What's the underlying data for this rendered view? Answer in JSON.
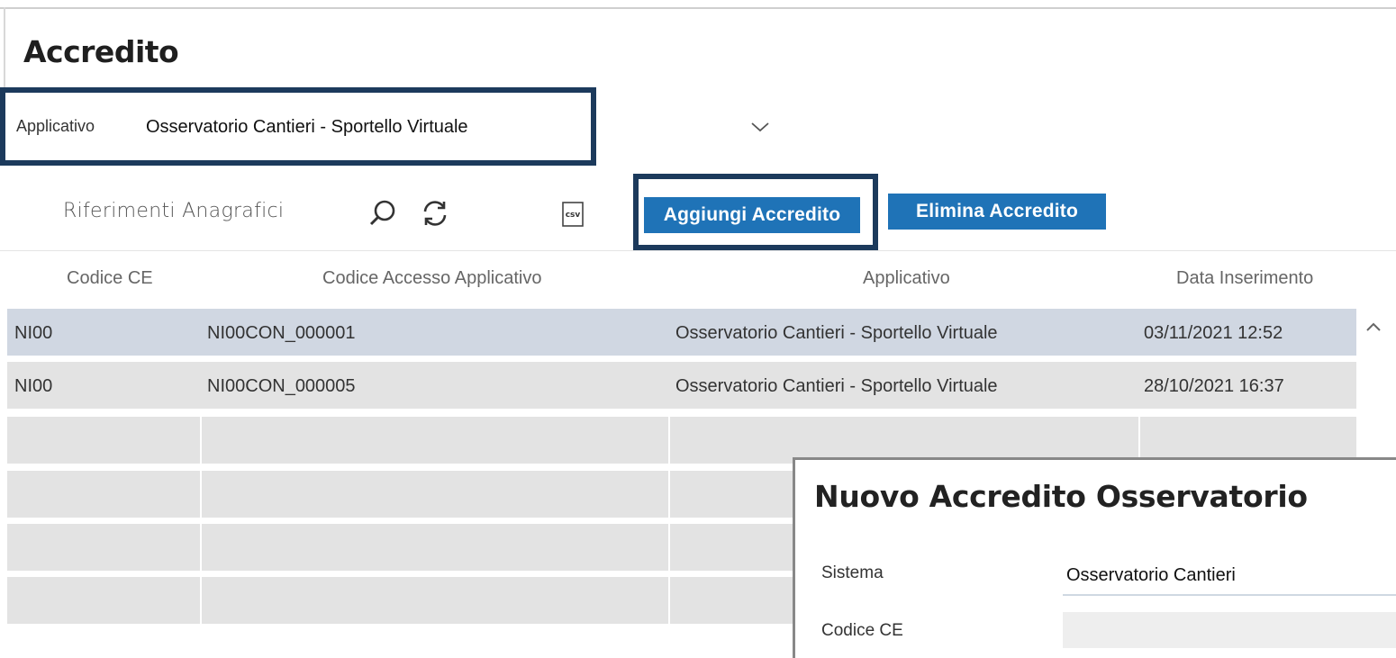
{
  "page": {
    "title": "Accredito"
  },
  "applicativo": {
    "label": "Applicativo",
    "value": "Osservatorio Cantieri - Sportello Virtuale"
  },
  "toolbar": {
    "riferimenti_label": "Riferimenti Anagrafici",
    "csv_icon_text": "csv",
    "add_label": "Aggiungi Accredito",
    "delete_label": "Elimina Accredito"
  },
  "table": {
    "headers": [
      "Codice CE",
      "Codice Accesso Applicativo",
      "Applicativo",
      "Data Inserimento"
    ],
    "rows": [
      [
        "NI00",
        "NI00CON_000001",
        "Osservatorio Cantieri - Sportello Virtuale",
        "03/11/2021 12:52"
      ],
      [
        "NI00",
        "NI00CON_000005",
        "Osservatorio Cantieri - Sportello Virtuale",
        "28/10/2021 16:37"
      ]
    ]
  },
  "modal": {
    "title": "Nuovo Accredito Osservatorio",
    "sistema_label": "Sistema",
    "sistema_value": "Osservatorio Cantieri",
    "codice_ce_label": "Codice CE",
    "codice_ce_value": ""
  },
  "colors": {
    "accent": "#1f73b7",
    "highlight_border": "#1c3a5c",
    "selected_row": "#d0d7e2",
    "row": "#e3e3e3"
  }
}
